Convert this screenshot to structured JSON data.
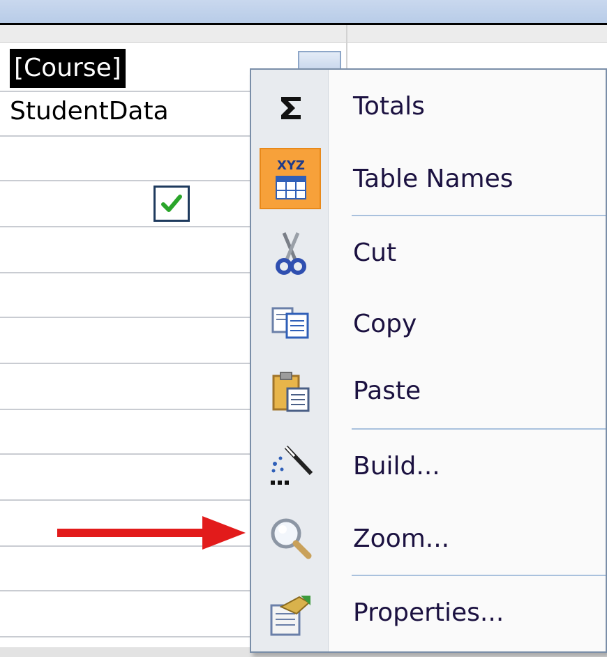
{
  "grid": {
    "field_value": "[Course]",
    "table_value": "StudentData",
    "show_checked": true
  },
  "context_menu": {
    "items": [
      {
        "id": "totals",
        "label": "Totals",
        "icon": "sigma-icon"
      },
      {
        "id": "table-names",
        "label": "Table Names",
        "icon": "table-names-icon"
      },
      {
        "id": "cut",
        "label": "Cut",
        "icon": "scissors-icon"
      },
      {
        "id": "copy",
        "label": "Copy",
        "icon": "copy-icon"
      },
      {
        "id": "paste",
        "label": "Paste",
        "icon": "paste-icon"
      },
      {
        "id": "build",
        "label": "Build...",
        "icon": "magic-wand-icon"
      },
      {
        "id": "zoom",
        "label": "Zoom...",
        "icon": "magnifier-icon"
      },
      {
        "id": "properties",
        "label": "Properties...",
        "icon": "properties-icon"
      }
    ]
  },
  "annotation": {
    "arrow_color": "#e21b1b",
    "points_to": "zoom"
  },
  "colors": {
    "highlight": "#f7a13a",
    "menu_text": "#1b1140",
    "separator": "#a9c1dd"
  }
}
